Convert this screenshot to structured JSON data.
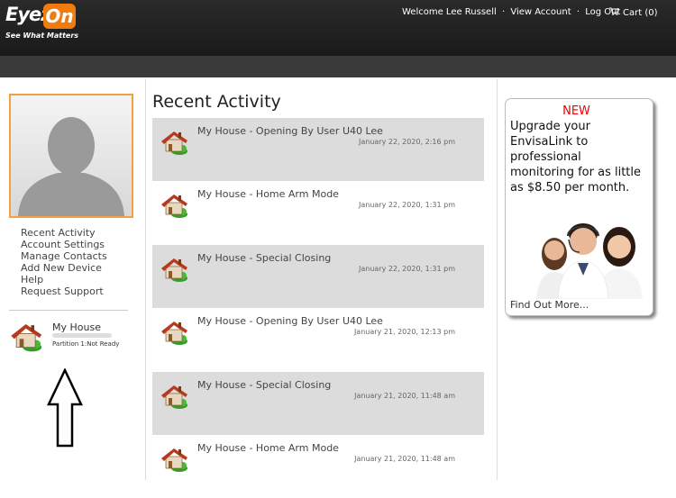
{
  "header": {
    "logo_main": "Eyez",
    "logo_on": "On",
    "logo_tagline": "See What Matters",
    "welcome": "Welcome Lee Russell",
    "view_account": "View Account",
    "logout": "Log Out",
    "cart": "Cart (0)",
    "separator": "·"
  },
  "sidebar": {
    "nav": [
      "Recent Activity",
      "Account Settings",
      "Manage Contacts",
      "Add New Device",
      "Help",
      "Request Support"
    ],
    "device": {
      "name": "My House",
      "status": "Partition 1:Not Ready"
    }
  },
  "main": {
    "title": "Recent Activity",
    "activities": [
      {
        "title": "My House - Opening By User U40 Lee",
        "date": "January 22, 2020, 2:16 pm"
      },
      {
        "title": "My House - Home Arm Mode",
        "date": "January 22, 2020, 1:31 pm"
      },
      {
        "title": "My House - Special Closing",
        "date": "January 22, 2020, 1:31 pm"
      },
      {
        "title": "My House - Opening By User U40 Lee",
        "date": "January 21, 2020, 12:13 pm"
      },
      {
        "title": "My House - Special Closing",
        "date": "January 21, 2020, 11:48 am"
      },
      {
        "title": "My House - Home Arm Mode",
        "date": "January 21, 2020, 11:48 am"
      }
    ]
  },
  "promo": {
    "badge": "NEW",
    "text": "Upgrade your EnvisaLink to professional monitoring for as little as $8.50 per month.",
    "link": "Find Out More..."
  },
  "colors": {
    "accent": "#f07c10",
    "new": "#ee0000",
    "shade": "#dcdcdc"
  },
  "icons": {
    "house": "house-icon",
    "cart": "cart-icon",
    "arrow": "up-arrow-icon"
  }
}
